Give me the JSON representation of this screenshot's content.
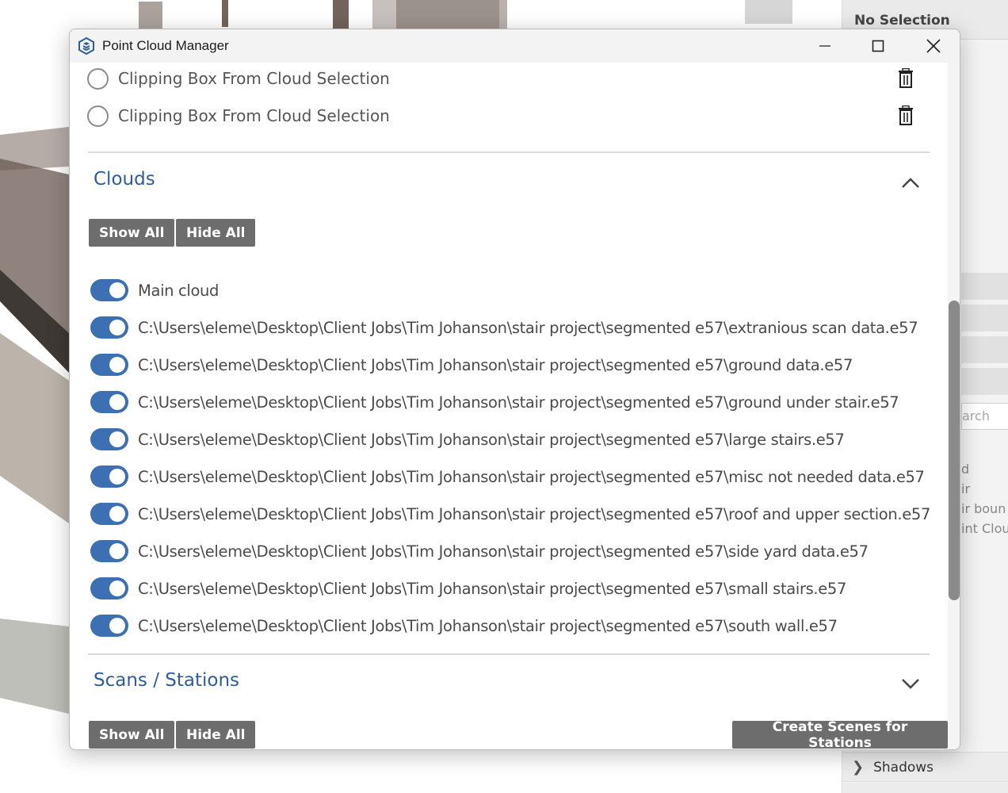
{
  "right_panel": {
    "header": "No Selection",
    "search_fragment": "arch",
    "snippets": [
      "d",
      "ir",
      "ir boun",
      "int Clou"
    ],
    "footer_item": "Shadows"
  },
  "dialog": {
    "title": "Point Cloud Manager",
    "window_controls": {
      "minimize_icon": "minimize-icon",
      "maximize_icon": "maximize-icon",
      "close_icon": "close-icon"
    },
    "clipping_boxes": [
      {
        "label": "Clipping Box From Cloud Selection",
        "selected": false
      },
      {
        "label": "Clipping Box From Cloud Selection",
        "selected": false
      }
    ],
    "clouds": {
      "title": "Clouds",
      "expanded": true,
      "show_all_label": "Show All",
      "hide_all_label": "Hide All",
      "items": [
        {
          "label": "Main cloud",
          "on": true
        },
        {
          "label": "C:\\Users\\eleme\\Desktop\\Client Jobs\\Tim Johanson\\stair project\\segmented e57\\extranious scan data.e57",
          "on": true
        },
        {
          "label": "C:\\Users\\eleme\\Desktop\\Client Jobs\\Tim Johanson\\stair project\\segmented e57\\ground data.e57",
          "on": true
        },
        {
          "label": "C:\\Users\\eleme\\Desktop\\Client Jobs\\Tim Johanson\\stair project\\segmented e57\\ground under stair.e57",
          "on": true
        },
        {
          "label": "C:\\Users\\eleme\\Desktop\\Client Jobs\\Tim Johanson\\stair project\\segmented e57\\large stairs.e57",
          "on": true
        },
        {
          "label": "C:\\Users\\eleme\\Desktop\\Client Jobs\\Tim Johanson\\stair project\\segmented e57\\misc not needed data.e57",
          "on": true
        },
        {
          "label": "C:\\Users\\eleme\\Desktop\\Client Jobs\\Tim Johanson\\stair project\\segmented e57\\roof and upper section.e57",
          "on": true
        },
        {
          "label": "C:\\Users\\eleme\\Desktop\\Client Jobs\\Tim Johanson\\stair project\\segmented e57\\side yard data.e57",
          "on": true
        },
        {
          "label": "C:\\Users\\eleme\\Desktop\\Client Jobs\\Tim Johanson\\stair project\\segmented e57\\small stairs.e57",
          "on": true
        },
        {
          "label": "C:\\Users\\eleme\\Desktop\\Client Jobs\\Tim Johanson\\stair project\\segmented e57\\south wall.e57",
          "on": true
        }
      ]
    },
    "scans": {
      "title": "Scans / Stations",
      "expanded": false,
      "show_all_label": "Show All",
      "hide_all_label": "Hide All",
      "create_scenes_label": "Create Scenes for Stations"
    }
  },
  "colors": {
    "accent": "#3d6fb3",
    "section_title": "#2f5d99",
    "button_bg": "#6d6d6d"
  }
}
